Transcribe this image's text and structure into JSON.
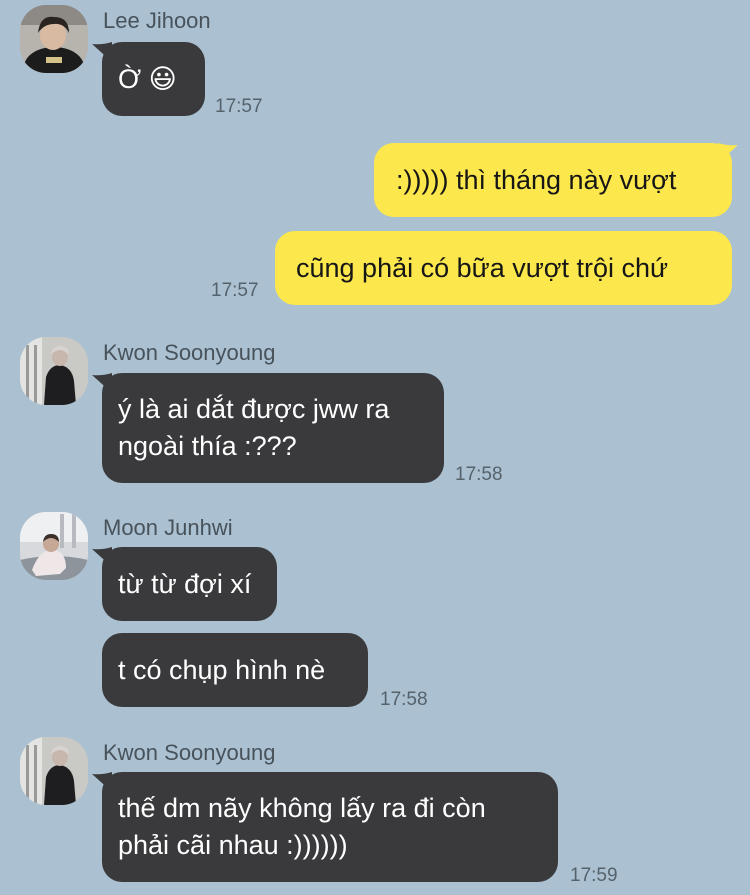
{
  "colors": {
    "background": "#abc1d1",
    "incoming_bubble": "#3a3a3c",
    "outgoing_bubble": "#fce74d"
  },
  "messages": [
    {
      "sender": "Lee Jihoon",
      "text": "Ờ 😃",
      "time": "17:57"
    },
    {
      "text": ":))))) thì tháng này vượt"
    },
    {
      "text": "cũng phải có bữa vượt trội chứ",
      "time": "17:57"
    },
    {
      "sender": "Kwon Soonyoung",
      "lines": [
        "ý là ai dắt được jww ra",
        "ngoài thía :???"
      ],
      "time": "17:58"
    },
    {
      "sender": "Moon Junhwi",
      "text": "từ từ đợi xí"
    },
    {
      "text": "t có chụp hình nè",
      "time": "17:58"
    },
    {
      "sender": "Kwon Soonyoung",
      "lines": [
        "thế dm nãy không lấy ra đi còn",
        "phải cãi nhau :))))))"
      ],
      "time": "17:59"
    }
  ]
}
